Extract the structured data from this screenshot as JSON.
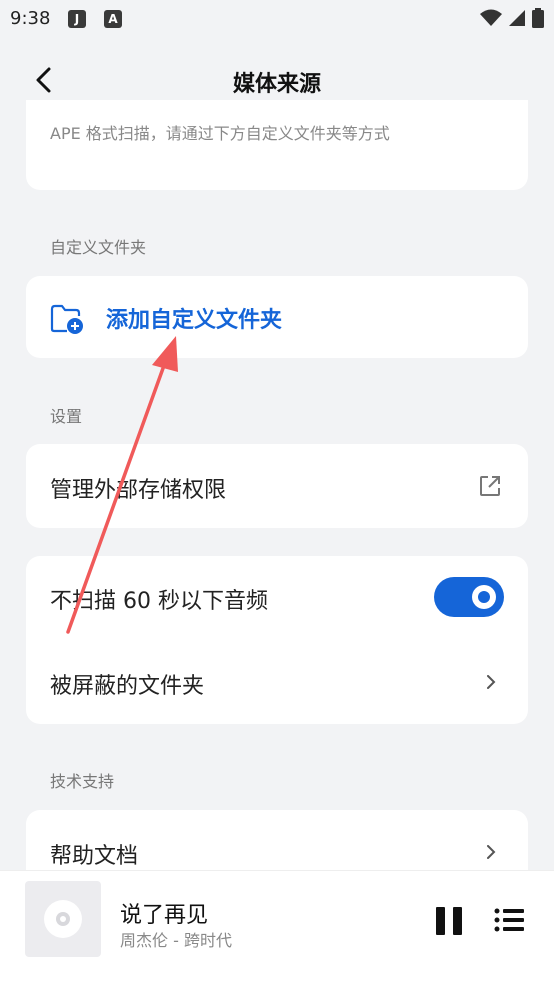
{
  "status_bar": {
    "time": "9:38",
    "icon_1": "J",
    "icon_2": "A"
  },
  "header": {
    "title": "媒体来源",
    "back_icon": "chevron-left-icon"
  },
  "description": {
    "text": "APE 格式扫描，请通过下方自定义文件夹等方式"
  },
  "custom_folder_section": {
    "label": "自定义文件夹",
    "add_button_label": "添加自定义文件夹",
    "add_icon": "folder-plus-icon"
  },
  "settings_section": {
    "label": "设置",
    "manage_storage_label": "管理外部存储权限",
    "manage_storage_icon": "external-link-icon",
    "skip_short_audio_label": "不扫描 60 秒以下音频",
    "skip_short_audio_enabled": true,
    "blocked_folders_label": "被屏蔽的文件夹"
  },
  "support_section": {
    "label": "技术支持",
    "help_docs_label": "帮助文档"
  },
  "player": {
    "song_title": "说了再见",
    "song_artist": "周杰伦 - 跨时代",
    "pause_icon": "pause-icon",
    "playlist_icon": "playlist-icon"
  },
  "colors": {
    "accent": "#1565d8",
    "annotation_arrow": "#f05a5a",
    "background": "#f2f3f5"
  }
}
